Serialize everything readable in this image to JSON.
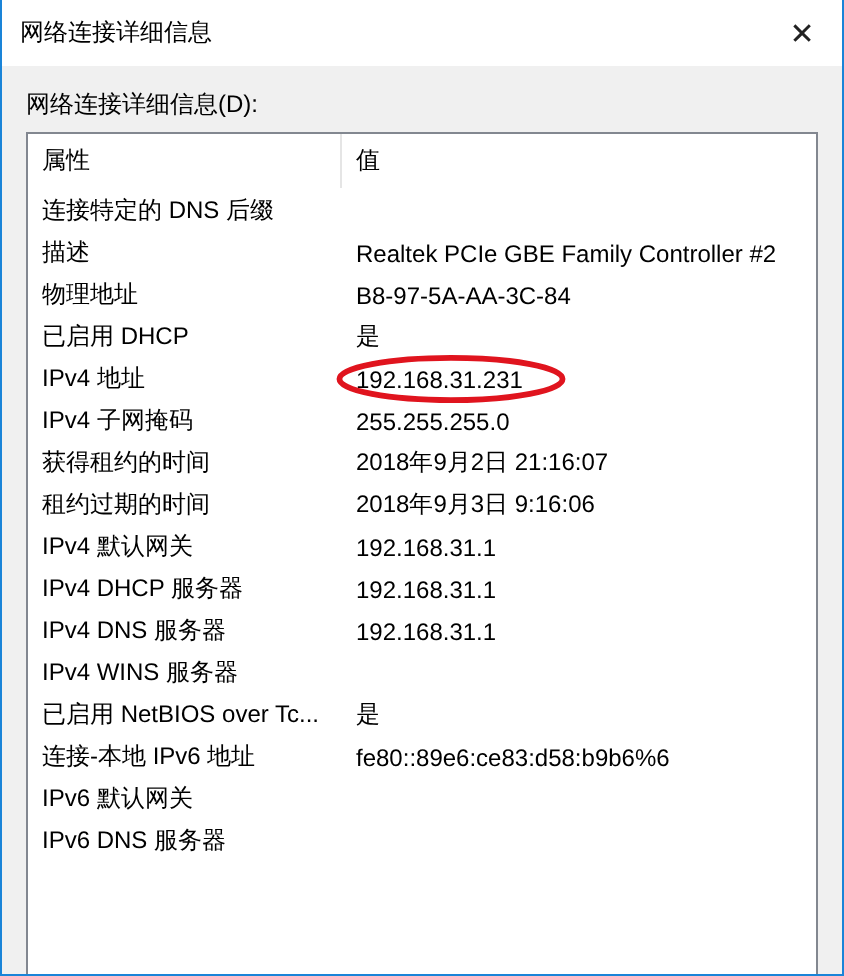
{
  "window": {
    "title": "网络连接详细信息",
    "close": "✕"
  },
  "label": "网络连接详细信息(D):",
  "table": {
    "columns": [
      "属性",
      "值"
    ],
    "rows": [
      {
        "property": "连接特定的 DNS 后缀",
        "value": ""
      },
      {
        "property": "描述",
        "value": "Realtek PCIe GBE Family Controller #2"
      },
      {
        "property": "物理地址",
        "value": "B8-97-5A-AA-3C-84"
      },
      {
        "property": "已启用 DHCP",
        "value": "是"
      },
      {
        "property": "IPv4 地址",
        "value": "192.168.31.231",
        "highlighted": true
      },
      {
        "property": "IPv4 子网掩码",
        "value": "255.255.255.0"
      },
      {
        "property": "获得租约的时间",
        "value": "2018年9月2日 21:16:07"
      },
      {
        "property": "租约过期的时间",
        "value": "2018年9月3日 9:16:06"
      },
      {
        "property": "IPv4 默认网关",
        "value": "192.168.31.1"
      },
      {
        "property": "IPv4 DHCP 服务器",
        "value": "192.168.31.1"
      },
      {
        "property": "IPv4 DNS 服务器",
        "value": "192.168.31.1"
      },
      {
        "property": "IPv4 WINS 服务器",
        "value": ""
      },
      {
        "property": "已启用 NetBIOS over Tc...",
        "value": "是"
      },
      {
        "property": "连接-本地 IPv6 地址",
        "value": "fe80::89e6:ce83:d58:b9b6%6"
      },
      {
        "property": "IPv6 默认网关",
        "value": ""
      },
      {
        "property": "IPv6 DNS 服务器",
        "value": ""
      }
    ]
  }
}
